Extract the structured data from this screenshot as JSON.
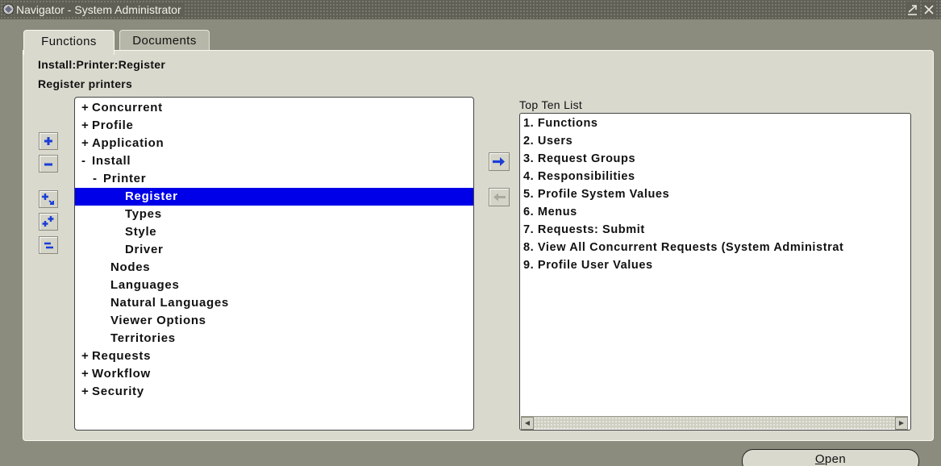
{
  "window": {
    "title": "Navigator - System Administrator",
    "controls": {
      "minimize_icon": "minimize-icon",
      "close_icon": "close-icon"
    }
  },
  "tabs": [
    {
      "label": "Functions",
      "active": true
    },
    {
      "label": "Documents",
      "active": false
    }
  ],
  "header": {
    "function_path": "Install:Printer:Register",
    "description": "Register printers"
  },
  "tree": {
    "selected": "Register",
    "nodes": [
      {
        "prefix": "+",
        "label": "Concurrent",
        "level": 0
      },
      {
        "prefix": "+",
        "label": "Profile",
        "level": 0
      },
      {
        "prefix": "+",
        "label": "Application",
        "level": 0
      },
      {
        "prefix": "-",
        "label": "Install",
        "level": 0
      },
      {
        "prefix": "-",
        "label": "Printer",
        "level": 1
      },
      {
        "prefix": "",
        "label": "Register",
        "level": 2
      },
      {
        "prefix": "",
        "label": "Types",
        "level": 2
      },
      {
        "prefix": "",
        "label": "Style",
        "level": 2
      },
      {
        "prefix": "",
        "label": "Driver",
        "level": 2
      },
      {
        "prefix": "",
        "label": "Nodes",
        "level": 1
      },
      {
        "prefix": "",
        "label": "Languages",
        "level": 1
      },
      {
        "prefix": "",
        "label": "Natural Languages",
        "level": 1
      },
      {
        "prefix": "",
        "label": "Viewer Options",
        "level": 1
      },
      {
        "prefix": "",
        "label": "Territories",
        "level": 1
      },
      {
        "prefix": "+",
        "label": "Requests",
        "level": 0
      },
      {
        "prefix": "+",
        "label": "Workflow",
        "level": 0
      },
      {
        "prefix": "+",
        "label": "Security",
        "level": 0
      }
    ]
  },
  "side_buttons": [
    "expand-icon",
    "collapse-icon",
    "expand-branch-icon",
    "expand-all-icon",
    "collapse-all-icon"
  ],
  "transfer": {
    "add_icon": "arrow-right-icon",
    "remove_icon": "arrow-left-icon"
  },
  "top_ten": {
    "label": "Top Ten List",
    "items": [
      "1. Functions",
      "2. Users",
      "3. Request Groups",
      "4. Responsibilities",
      "5. Profile System Values",
      "6. Menus",
      "7. Requests: Submit",
      "8. View All Concurrent Requests (System Administrat",
      "9. Profile User Values"
    ]
  },
  "actions": {
    "open_mnemonic": "O",
    "open_rest": "pen"
  },
  "colors": {
    "selection": "#0000e8",
    "arrow": "#1a3ed8",
    "panel": "#d9d9ce",
    "background": "#8c8c7e"
  }
}
